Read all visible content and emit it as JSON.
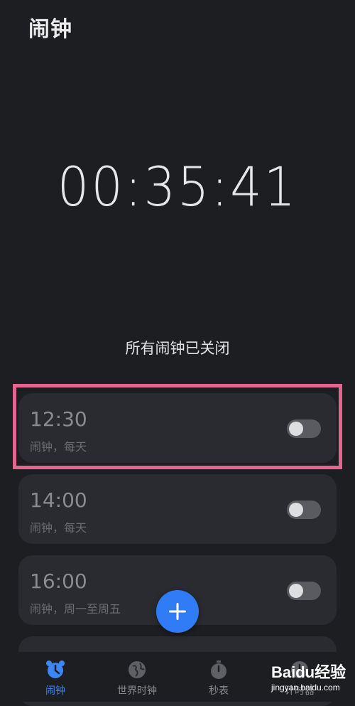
{
  "header": {
    "title": "闹钟"
  },
  "countdown": {
    "time": "00:35:41"
  },
  "status": {
    "text": "所有闹钟已关闭"
  },
  "alarms": [
    {
      "time": "12:30",
      "desc": "闹钟，每天",
      "enabled": false
    },
    {
      "time": "14:00",
      "desc": "闹钟，每天",
      "enabled": false
    },
    {
      "time": "16:00",
      "desc": "闹钟，周一至周五",
      "enabled": false
    }
  ],
  "fab": {
    "icon": "plus-icon"
  },
  "nav": {
    "items": [
      {
        "label": "闹钟",
        "icon": "alarm-clock-icon",
        "active": true
      },
      {
        "label": "世界时钟",
        "icon": "globe-icon",
        "active": false
      },
      {
        "label": "秒表",
        "icon": "stopwatch-icon",
        "active": false
      },
      {
        "label": "计时器",
        "icon": "timer-icon",
        "active": false
      }
    ]
  },
  "watermark": {
    "brand": "Baidu经验",
    "url": "jingyan.baidu.com"
  },
  "colors": {
    "background": "#1d1e22",
    "card": "#2a2b30",
    "accent": "#2f7cf6",
    "highlight": "#e4668f"
  }
}
